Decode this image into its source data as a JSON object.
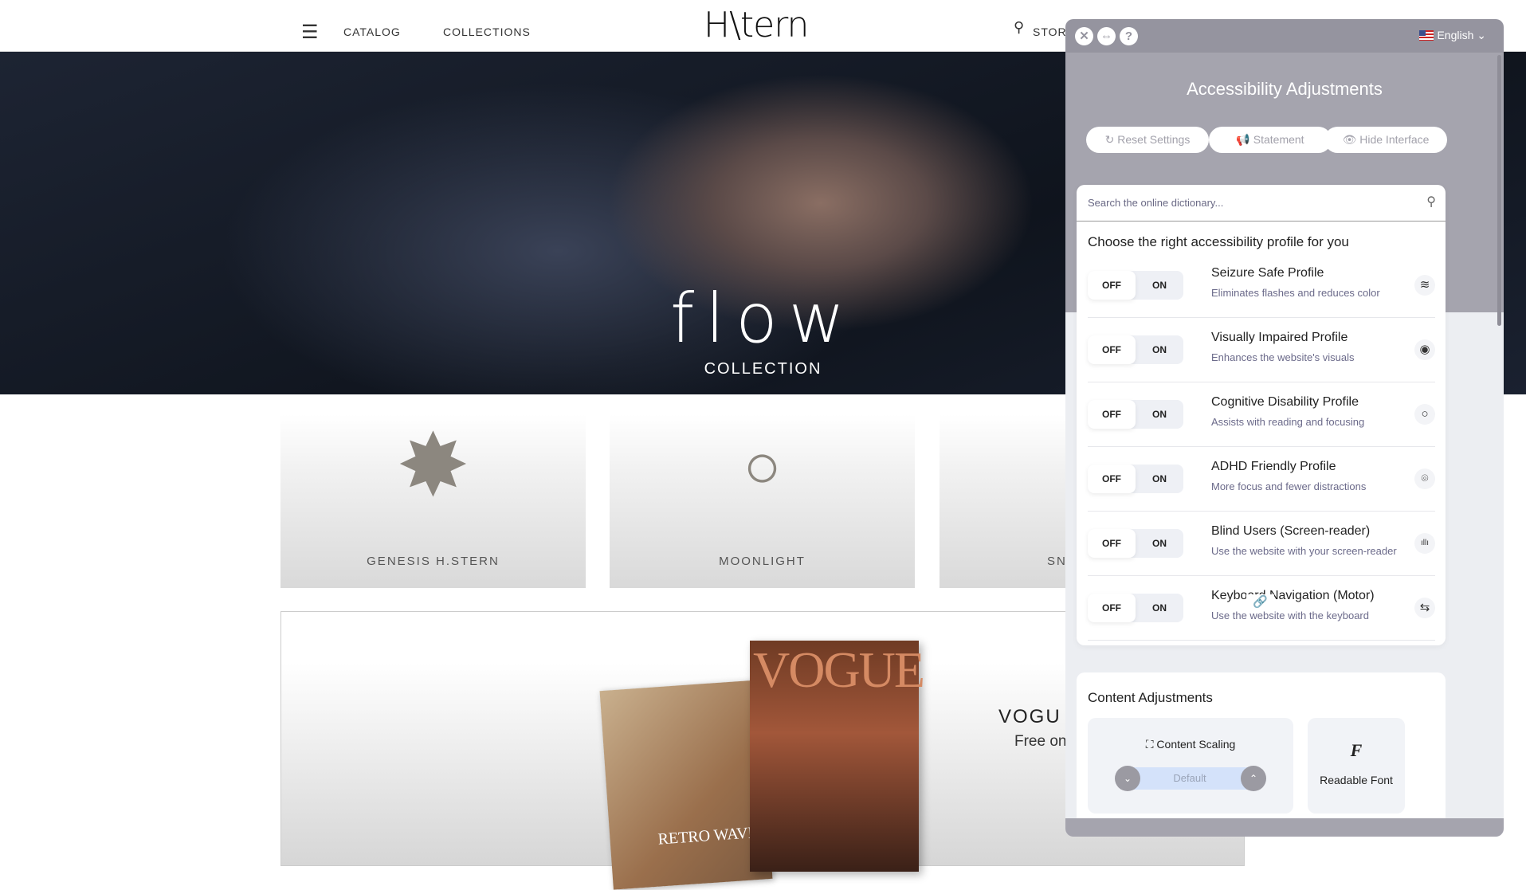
{
  "site": {
    "logo": "H\\tern",
    "nav": [
      "CATALOG",
      "COLLECTIONS"
    ],
    "stores_label": "STOR",
    "hero": {
      "title": "flow",
      "subtitle": "COLLECTION"
    },
    "products": [
      "GENESIS H.STERN",
      "MOONLIGHT",
      "SN"
    ],
    "vogue": {
      "title": "VOGU",
      "subtitle": "Free on",
      "cover_title": "VOGUE",
      "cover2_title": "RETRO WAVE"
    }
  },
  "panel": {
    "language": "English",
    "title": "Accessibility Adjustments",
    "buttons": [
      "Reset Settings",
      "Statement",
      "Hide Interface"
    ],
    "search_placeholder": "Search the online dictionary...",
    "profiles_heading": "Choose the right accessibility profile for you",
    "toggle_off": "OFF",
    "toggle_on": "ON",
    "profiles": [
      {
        "title": "Seizure Safe Profile",
        "desc": "Eliminates flashes and reduces color",
        "icon": "waves-icon"
      },
      {
        "title": "Visually Impaired Profile",
        "desc": "Enhances the website's visuals",
        "icon": "eye-icon"
      },
      {
        "title": "Cognitive Disability Profile",
        "desc": "Assists with reading and focusing",
        "icon": "circle-icon"
      },
      {
        "title": "ADHD Friendly Profile",
        "desc": "More focus and fewer distractions",
        "icon": "focus-icon"
      },
      {
        "title": "Blind Users (Screen-reader)",
        "desc": "Use the website with your screen-reader",
        "icon": "audio-wave-icon"
      },
      {
        "title": "Keyboard Navigation (Motor)",
        "desc": "Use the website with the keyboard",
        "icon": "arrows-swap-icon"
      }
    ],
    "content_heading": "Content Adjustments",
    "content_scaling": {
      "label": "Content Scaling",
      "value": "Default"
    },
    "readable_font": "Readable Font"
  }
}
